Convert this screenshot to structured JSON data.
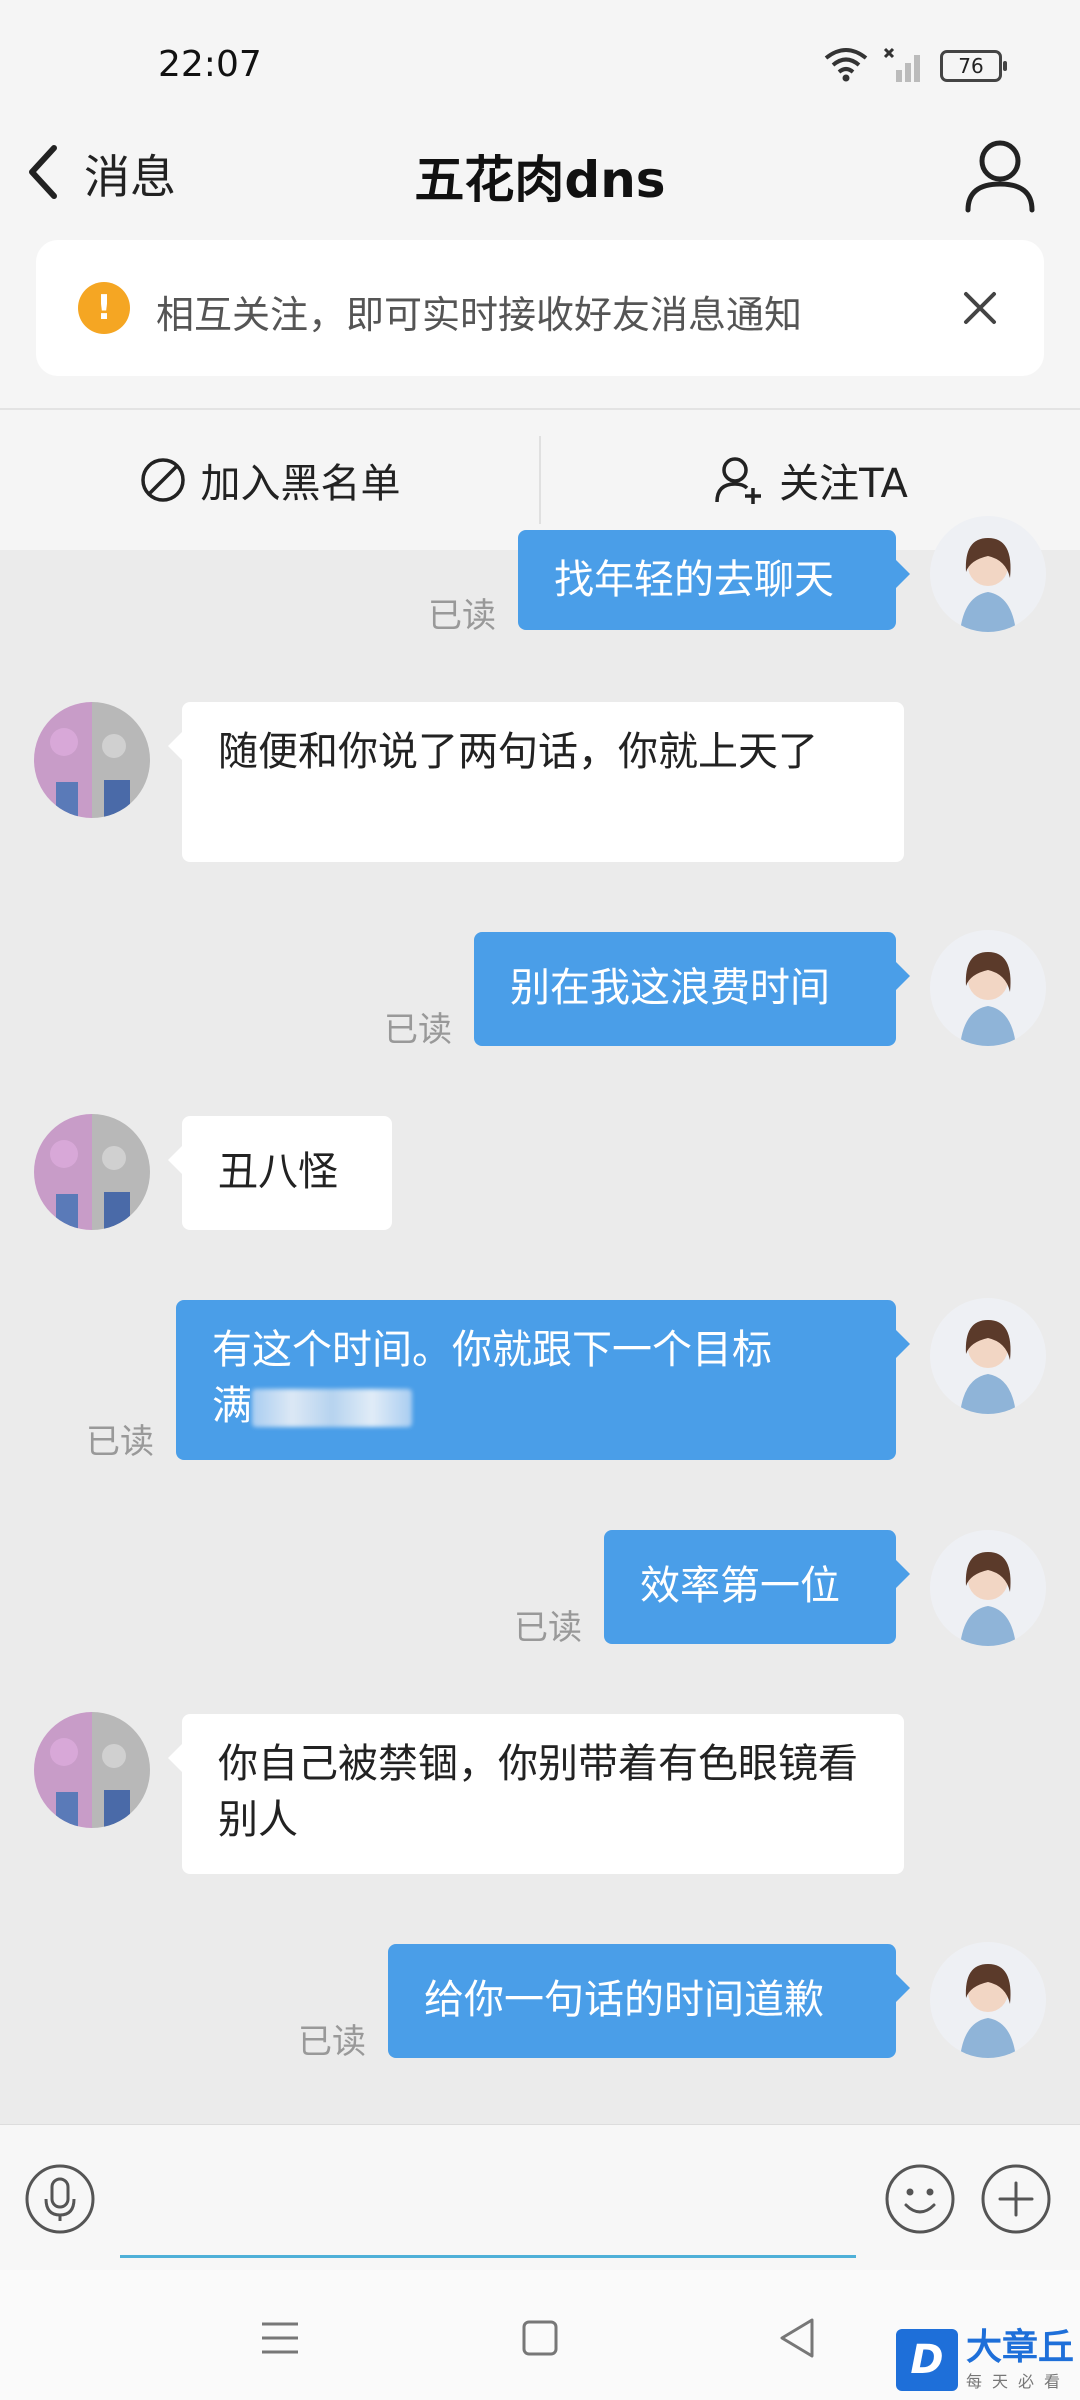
{
  "status_bar": {
    "time": "22:07",
    "battery": "76"
  },
  "nav": {
    "back_label": "消息",
    "title": "五花肉dns"
  },
  "notice": {
    "icon": "!",
    "text": "相互关注，即可实时接收好友消息通知"
  },
  "actions": {
    "block_label": "加入黑名单",
    "follow_label": "关注TA"
  },
  "messages": [
    {
      "dir": "out",
      "text": "找年轻的去聊天",
      "read": "已读"
    },
    {
      "dir": "in",
      "text": "随便和你说了两句话，你就上天了"
    },
    {
      "dir": "out",
      "text": "别在我这浪费时间",
      "read": "已读"
    },
    {
      "dir": "in",
      "text": "丑八怪"
    },
    {
      "dir": "out",
      "text": "有这个时间。你就跟下一个目标",
      "text2": "满",
      "read": "已读"
    },
    {
      "dir": "out",
      "text": "效率第一位",
      "read": "已读"
    },
    {
      "dir": "in",
      "text": "你自己被禁锢，你别带着有色眼镜看别人"
    },
    {
      "dir": "out",
      "text": "给你一句话的时间道歉",
      "read": "已读"
    }
  ],
  "input": {
    "value": ""
  },
  "watermark": {
    "logo": "D",
    "title": "大章丘",
    "sub": "每天必看"
  },
  "colors": {
    "out_bubble": "#4a9ee8",
    "in_bubble": "#ffffff",
    "notice_icon": "#f5a623",
    "input_line": "#4fb0d8"
  }
}
